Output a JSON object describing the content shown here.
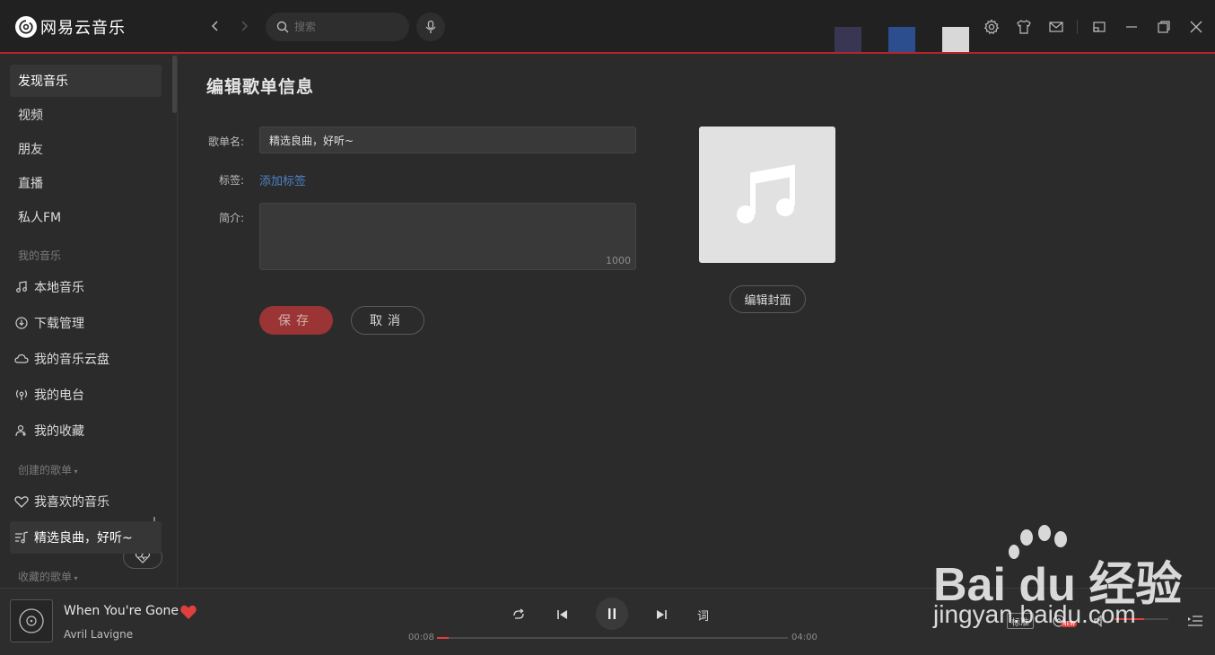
{
  "app": {
    "name": "网易云音乐"
  },
  "search": {
    "placeholder": "搜索"
  },
  "swatch_colors": [
    "#383652",
    "#2c4e8f",
    "#d8d8d8"
  ],
  "sidebar": {
    "top_items": [
      {
        "label": "发现音乐"
      },
      {
        "label": "视频"
      },
      {
        "label": "朋友"
      },
      {
        "label": "直播"
      },
      {
        "label": "私人FM"
      }
    ],
    "my_music_header": "我的音乐",
    "my_music": [
      {
        "label": "本地音乐",
        "icon": "music-note-icon"
      },
      {
        "label": "下载管理",
        "icon": "download-icon"
      },
      {
        "label": "我的音乐云盘",
        "icon": "cloud-icon"
      },
      {
        "label": "我的电台",
        "icon": "radio-icon"
      },
      {
        "label": "我的收藏",
        "icon": "favorites-icon"
      }
    ],
    "created_header": "创建的歌单",
    "created": [
      {
        "label": "我喜欢的音乐",
        "icon": "heart-icon"
      },
      {
        "label": "精选良曲，好听~",
        "icon": "playlist-icon"
      }
    ],
    "collected_header": "收藏的歌单"
  },
  "editor": {
    "title": "编辑歌单信息",
    "name_label": "歌单名:",
    "name_value": "精选良曲，好听~",
    "tag_label": "标签:",
    "add_tag": "添加标签",
    "desc_label": "简介:",
    "desc_count": "1000",
    "save_label": "保存",
    "cancel_label": "取消",
    "edit_cover_label": "编辑封面"
  },
  "player": {
    "song": "When You're Gone",
    "artist": "Avril Lavigne",
    "current_time": "00:08",
    "total_time": "04:00",
    "progress_fraction": 0.033,
    "lyric_label": "词",
    "quality_label": "标准",
    "new_badge": "NEW",
    "volume_fraction": 0.55,
    "accent": "#e13e3e"
  },
  "watermark": {
    "brand": "Bai du 经验",
    "url": "jingyan.baidu.com"
  }
}
